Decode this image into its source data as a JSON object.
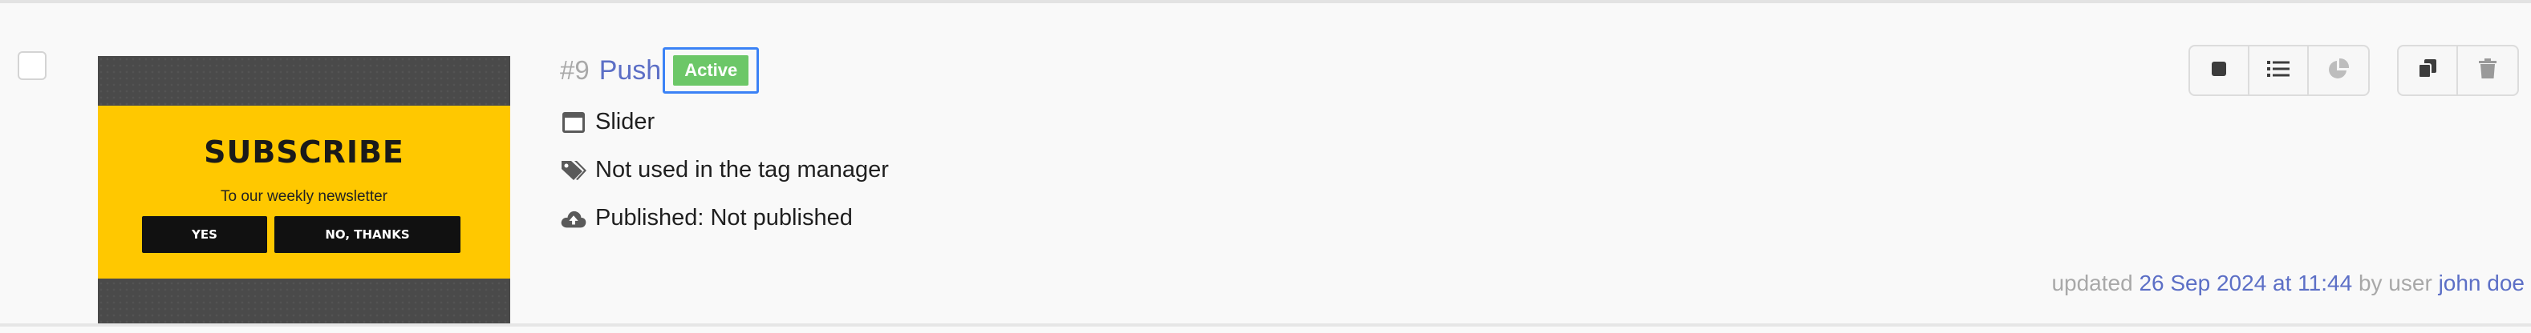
{
  "item": {
    "number": "#9",
    "name": "Push",
    "status": "Active",
    "meta": {
      "type": "Slider",
      "tag_manager": "Not used in the tag manager",
      "published": "Published: Not published"
    },
    "updated": {
      "prefix": "updated",
      "date": "26 Sep 2024 at 11:44",
      "by": "by user",
      "user": "john doe"
    }
  },
  "thumbnail": {
    "title": "SUBSCRIBE",
    "subtitle": "To our weekly newsletter",
    "yes_label": "YES",
    "no_label": "NO, THANKS"
  },
  "actions": {
    "group1": [
      "stop-icon",
      "list-icon",
      "pie-chart-icon"
    ],
    "group2": [
      "copy-icon",
      "trash-icon"
    ]
  },
  "colors": {
    "accent": "#5c6fc6",
    "active_badge": "#6cc768",
    "focus_ring": "#3b82f6",
    "thumbnail_band": "#ffc800"
  }
}
